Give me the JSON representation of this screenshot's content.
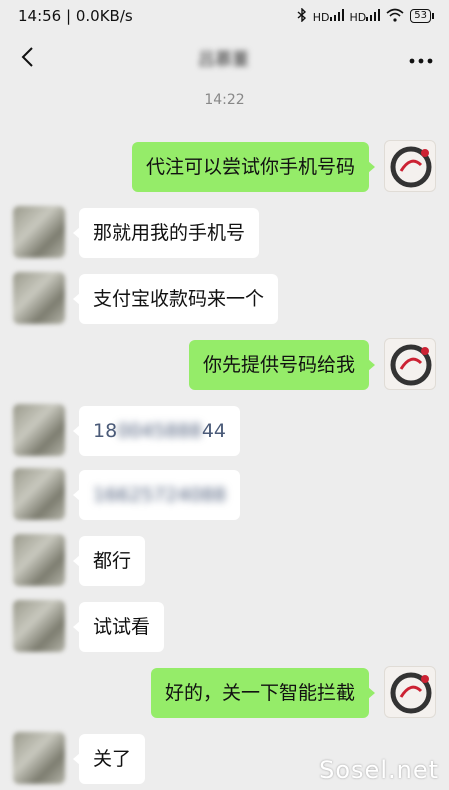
{
  "status_bar": {
    "time": "14:56",
    "speed": "0.0KB/s",
    "signal1": "HD",
    "signal2": "HD",
    "battery": "53"
  },
  "chat": {
    "title": "吕慕董",
    "timestamp": "14:22"
  },
  "messages": [
    {
      "side": "right",
      "text": "代注可以尝试你手机号码"
    },
    {
      "side": "left",
      "text": "那就用我的手机号"
    },
    {
      "side": "left",
      "text": "支付宝收款码来一个"
    },
    {
      "side": "right",
      "text": "你先提供号码给我"
    },
    {
      "side": "left",
      "text_a": "18",
      "text_b": "0045888",
      "text_c": "44"
    },
    {
      "side": "left",
      "text": "16625724088"
    },
    {
      "side": "left",
      "text": "都行"
    },
    {
      "side": "left",
      "text": "试试看"
    },
    {
      "side": "right",
      "text": "好的，关一下智能拦截"
    },
    {
      "side": "left",
      "text": "关了"
    }
  ],
  "watermark": "Sosel.net"
}
